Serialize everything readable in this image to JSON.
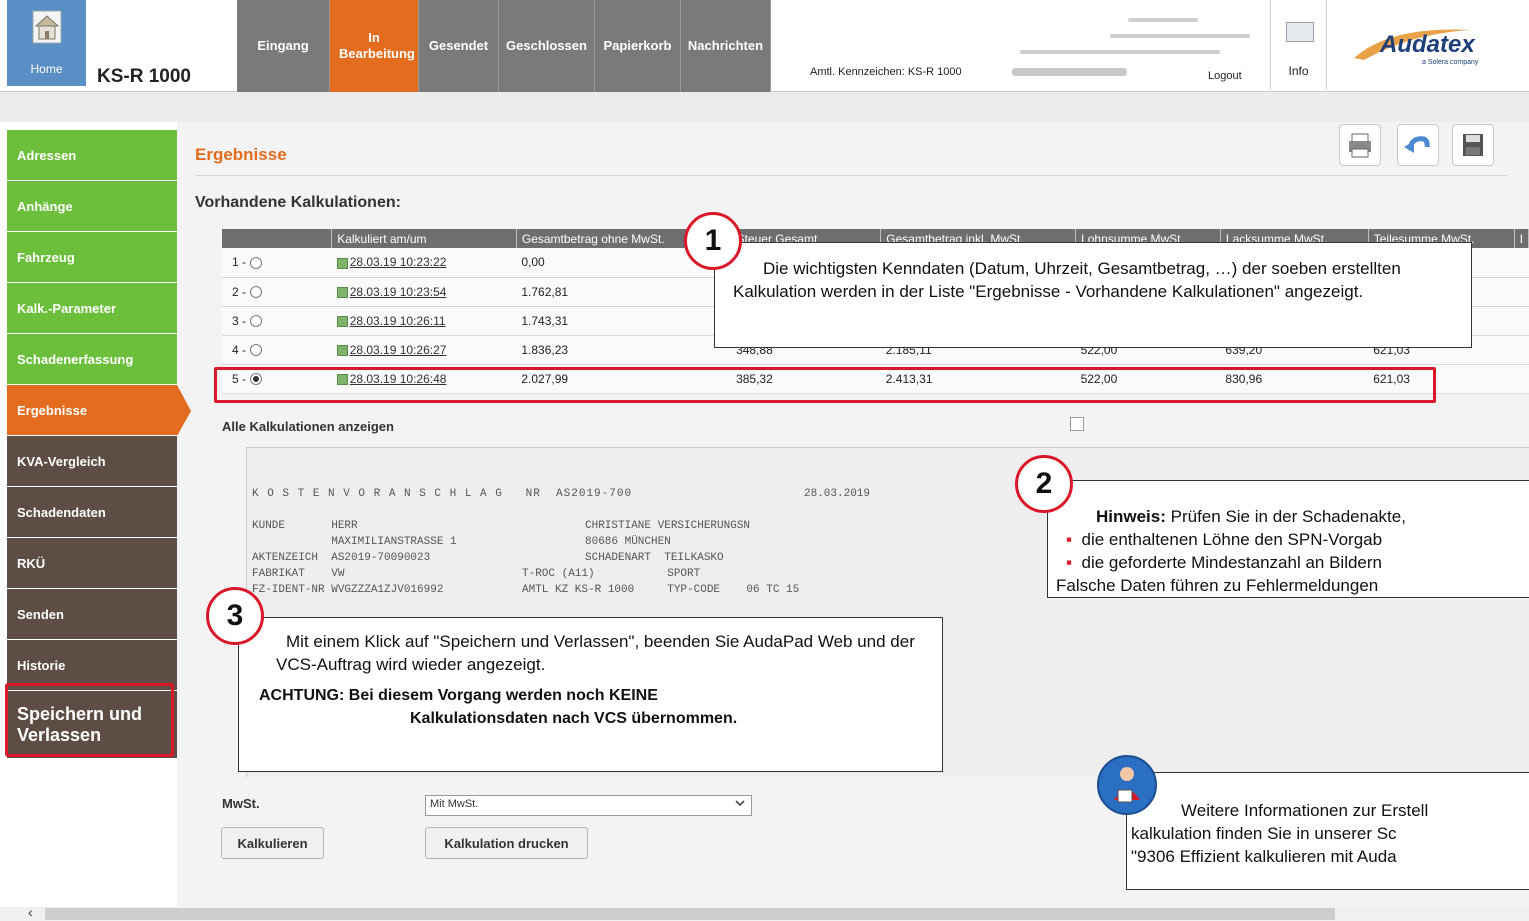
{
  "header": {
    "home_label": "Home",
    "case_title": "KS-R 1000",
    "tabs": [
      {
        "label": "Eingang"
      },
      {
        "label": "In Bearbeitung"
      },
      {
        "label": "Gesendet"
      },
      {
        "label": "Geschlossen"
      },
      {
        "label": "Papierkorb"
      },
      {
        "label": "Nachrichten"
      }
    ],
    "plate_label": "Amtl. Kennzeichen: KS-R 1000",
    "logout_label": "Logout",
    "info_label": "Info",
    "brand_name": "Audatex",
    "brand_tagline": "a Solera company"
  },
  "sidebar": {
    "items": [
      {
        "label": "Adressen"
      },
      {
        "label": "Anhänge"
      },
      {
        "label": "Fahrzeug"
      },
      {
        "label": "Kalk.-Parameter"
      },
      {
        "label": "Schadenerfassung"
      },
      {
        "label": "Ergebnisse"
      },
      {
        "label": "KVA-Vergleich"
      },
      {
        "label": "Schadendaten"
      },
      {
        "label": "RKÜ"
      },
      {
        "label": "Senden"
      },
      {
        "label": "Historie"
      },
      {
        "label": "Speichern und Verlassen"
      }
    ]
  },
  "main": {
    "page_title": "Ergebnisse",
    "section_title": "Vorhandene Kalkulationen:",
    "table": {
      "headers": [
        "",
        "Kalkuliert am/um",
        "Gesamtbetrag ohne MwSt.",
        "Steuer Gesamt",
        "Gesamtbetrag inkl. MwSt.",
        "Lohnsumme MwSt.",
        "Lacksumme MwSt.",
        "Teilesumme MwSt.",
        "I"
      ],
      "rows": [
        {
          "no": "1 -",
          "date": "28.03.19 10:23:22",
          "net": "0,00",
          "tax": "",
          "gross": "",
          "labor": "",
          "paint": "",
          "parts": ""
        },
        {
          "no": "2 -",
          "date": "28.03.19 10:23:54",
          "net": "1.762,81",
          "tax": "",
          "gross": "",
          "labor": "",
          "paint": "",
          "parts": ""
        },
        {
          "no": "3 -",
          "date": "28.03.19 10:26:11",
          "net": "1.743,31",
          "tax": "",
          "gross": "",
          "labor": "",
          "paint": "",
          "parts": ""
        },
        {
          "no": "4 -",
          "date": "28.03.19 10:26:27",
          "net": "1.836,23",
          "tax": "348,88",
          "gross": "2.185,11",
          "labor": "522,00",
          "paint": "639,20",
          "parts": "621,03"
        },
        {
          "no": "5 -",
          "date": "28.03.19 10:26:48",
          "net": "2.027,99",
          "tax": "385,32",
          "gross": "2.413,31",
          "labor": "522,00",
          "paint": "830,96",
          "parts": "621,03"
        }
      ]
    },
    "show_all_label": "Alle Kalkulationen anzeigen",
    "preview": {
      "line1a": "K O S T E N V O R A N S C H L A G   NR  AS2019-700",
      "line1b": "28.03.2019",
      "line2a": "KUNDE       HERR",
      "line2b": "CHRISTIANE VERSICHERUNGSN",
      "line3a": "            MAXIMILIANSTRASSE 1",
      "line3b": "80686 MÜNCHEN",
      "line4a": "AKTENZEICH  AS2019-70090023",
      "line4b": "SCHADENART  TEILKASKO",
      "line5a": "FABRIKAT    VW",
      "line5b": "T-ROC (A11)           SPORT",
      "line6a": "FZ-IDENT-NR WVGZZZA1ZJV016992",
      "line6b": "AMTL KZ KS-R 1000     TYP-CODE    06 TC 15"
    },
    "mwst_label": "MwSt.",
    "mwst_value": "Mit MwSt.",
    "calc_button": "Kalkulieren",
    "print_calc_button": "Kalkulation drucken"
  },
  "callouts": {
    "c1_number": "1",
    "c1_text": "Die wichtigsten Kenndaten (Datum, Uhrzeit, Gesamtbetrag, …) der soeben erstellten Kalkulation  werden in der Liste \"Ergebnisse - Vorhandene Kalkulationen\" angezeigt.",
    "c2_number": "2",
    "c2_bold": "Hinweis:",
    "c2_text": " Prüfen Sie in der Schadenakte,",
    "c2_bullet1": "die enthaltenen Löhne den SPN-Vorgab",
    "c2_bullet2": "die geforderte Mindestanzahl an Bildern",
    "c2_footer": "Falsche Daten führen zu Fehlermeldungen",
    "c3_number": "3",
    "c3_text": "Mit einem Klick auf \"Speichern und Verlassen\", beenden Sie AudaPad Web und der VCS-Auftrag wird wieder angezeigt.",
    "c3_warn1": "ACHTUNG: Bei diesem Vorgang werden noch KEINE",
    "c3_warn2": "Kalkulationsdaten nach VCS übernommen.",
    "c4_line1": "Weitere Informationen zur Erstell",
    "c4_line2": "kalkulation finden Sie in unserer Sc",
    "c4_line3": "\"9306 Effizient kalkulieren mit Auda"
  },
  "colors": {
    "accent_orange": "#e36c1f",
    "nav_gray": "#7a7a7a",
    "sidebar_green": "#6cbf3a",
    "sidebar_brown": "#5d4d45",
    "highlight_red": "#d9182a",
    "home_blue": "#5a8fc5"
  },
  "icons": [
    "home-icon",
    "info-icon",
    "print-icon",
    "undo-icon",
    "save-icon",
    "edit-icon",
    "chevron-down-icon",
    "help-person-icon"
  ]
}
